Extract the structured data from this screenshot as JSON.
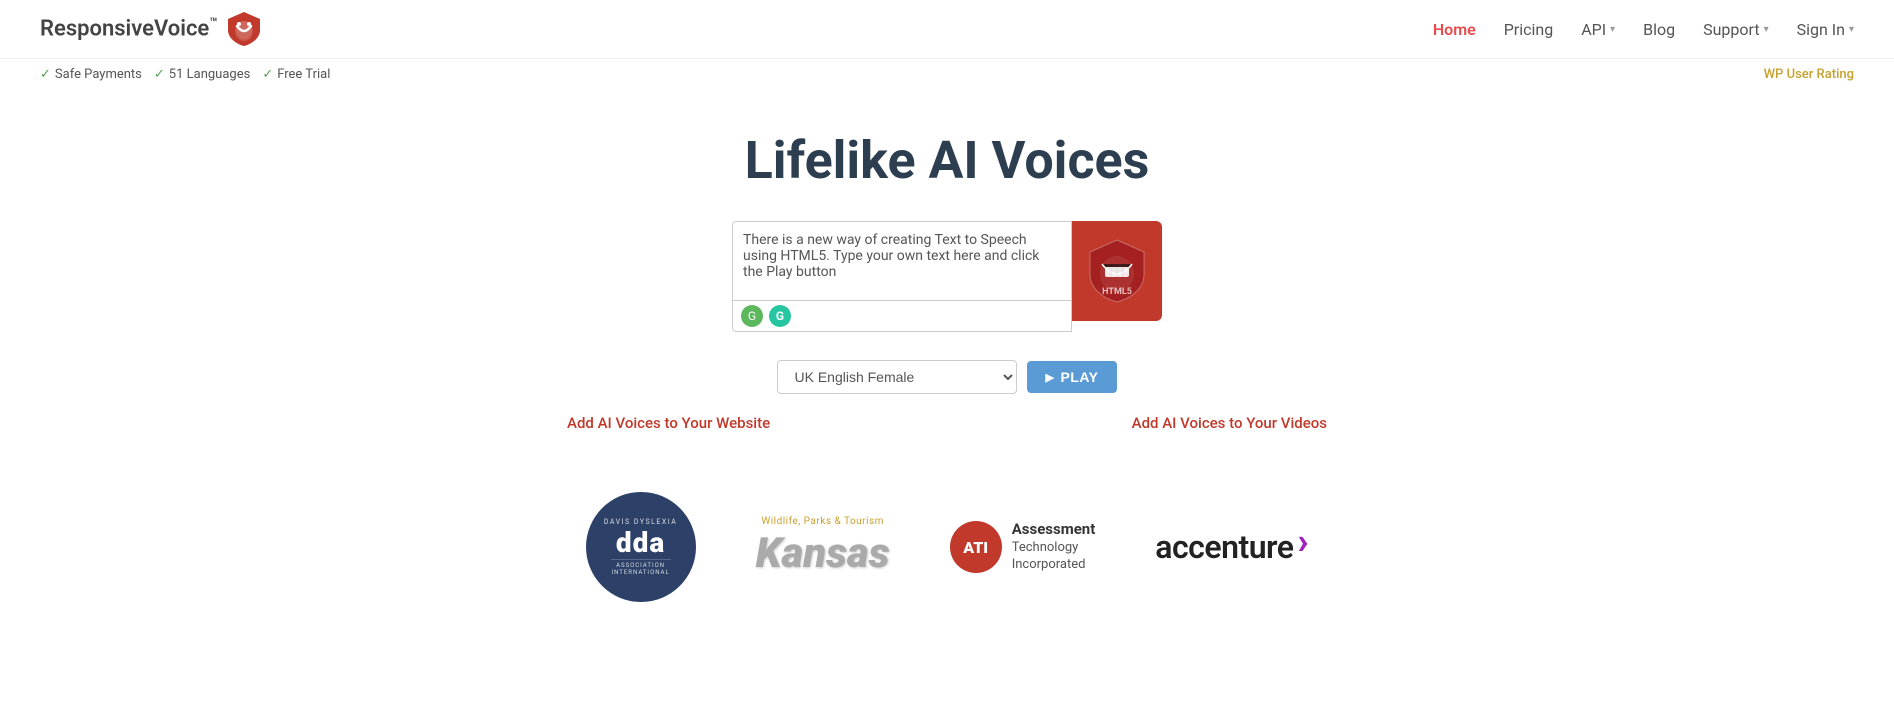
{
  "logo": {
    "text": "ResponsiveVoice",
    "tm": "™"
  },
  "nav": {
    "home": "Home",
    "pricing": "Pricing",
    "api": "API",
    "blog": "Blog",
    "support": "Support",
    "signin": "Sign In"
  },
  "sub_header": {
    "items": [
      "Safe Payments",
      "51 Languages",
      "Free Trial"
    ],
    "wp_rating": "WP User Rating"
  },
  "hero": {
    "title": "Lifelike AI Voices",
    "textarea_placeholder": "There is a new way of creating Text to Speech using HTML5. Type your own text here and click the Play button",
    "textarea_value": "There is a new way of creating Text to Speech using HTML5. Type your own text here and click the Play button",
    "voice_default": "UK English Female",
    "play_label": "PLAY",
    "link_website": "Add AI Voices to Your Website",
    "link_videos": "Add AI Voices to Your Videos"
  },
  "logos": {
    "dda": {
      "line1": "DAVIS DYSLEXIA",
      "line2": "dda",
      "line3": "ASSOCIATION INTERNATIONAL"
    },
    "kansas": {
      "subtitle": "Wildlife, Parks & Tourism",
      "text": "Kansas"
    },
    "ati": {
      "badge": "ATI",
      "line1": "Assessment",
      "line2": "Technology",
      "line3": "Incorporated"
    },
    "accenture": {
      "text": "accenture",
      "accent": "›"
    }
  },
  "colors": {
    "brand_red": "#c0392b",
    "nav_active": "#e84b4b",
    "play_blue": "#5b9bd5",
    "link_red": "#c0392b",
    "wp_rating_gold": "#c8a030"
  }
}
